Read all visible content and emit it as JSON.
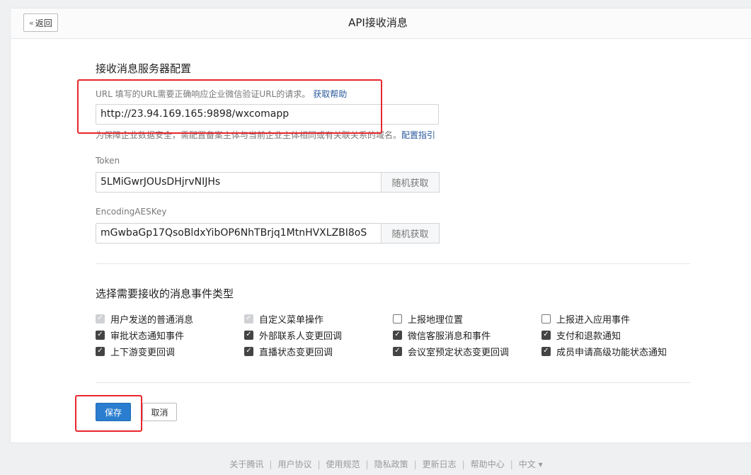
{
  "header": {
    "back_label": "返回",
    "title": "API接收消息"
  },
  "server_config": {
    "section_title": "接收消息服务器配置",
    "url_label": "URL  填写的URL需要正确响应企业微信验证URL的请求。",
    "url_help_link": "获取帮助",
    "url_value": "http://23.94.169.165:9898/wxcomapp",
    "domain_note": "为保障企业数据安全，需配置备案主体与当前企业主体相同或有关联关系的域名。",
    "domain_note_link": "配置指引",
    "token_label": "Token",
    "token_value": "5LMiGwrJOUsDHjrvNIJHs",
    "token_random_button": "随机获取",
    "aes_label": "EncodingAESKey",
    "aes_value": "mGwbaGp17QsoBldxYibOP6NhTBrjq1MtnHVXLZBI8oS",
    "aes_random_button": "随机获取"
  },
  "events": {
    "section_title": "选择需要接收的消息事件类型",
    "items": [
      {
        "label": "用户发送的普通消息",
        "state": "disabled-checked"
      },
      {
        "label": "自定义菜单操作",
        "state": "disabled-checked"
      },
      {
        "label": "上报地理位置",
        "state": "unchecked"
      },
      {
        "label": "上报进入应用事件",
        "state": "unchecked"
      },
      {
        "label": "审批状态通知事件",
        "state": "checked"
      },
      {
        "label": "外部联系人变更回调",
        "state": "checked"
      },
      {
        "label": "微信客服消息和事件",
        "state": "checked"
      },
      {
        "label": "支付和退款通知",
        "state": "checked"
      },
      {
        "label": "上下游变更回调",
        "state": "checked"
      },
      {
        "label": "直播状态变更回调",
        "state": "checked"
      },
      {
        "label": "会议室预定状态变更回调",
        "state": "checked"
      },
      {
        "label": "成员申请高级功能状态通知",
        "state": "checked"
      }
    ]
  },
  "actions": {
    "save_label": "保存",
    "cancel_label": "取消"
  },
  "footer": {
    "links": [
      "关于腾讯",
      "用户协议",
      "使用规范",
      "隐私政策",
      "更新日志",
      "帮助中心"
    ],
    "language": "中文 ▾"
  },
  "colors": {
    "primary": "#2b7ecf",
    "link": "#2a5a9c",
    "highlight": "#e8262b"
  },
  "icons": {
    "back": "double-chevron-left-icon",
    "check": "check-icon"
  }
}
